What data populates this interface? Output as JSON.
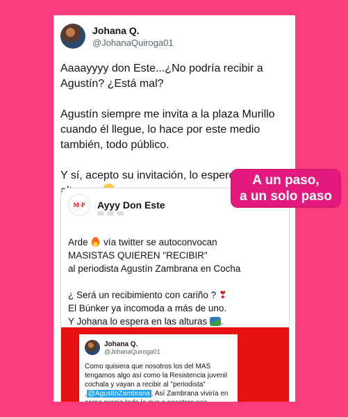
{
  "tweet": {
    "display_name": "Johana Q.",
    "handle": "@JohanaQuiroga01",
    "paragraphs": [
      "Aaaayyyy don Este...¿No podría recibir a Agustín? ¿Está mal?",
      "Agustín siempre me invita a la plaza Murillo cuando él llegue, lo hace por este medio también, todo público.",
      " Y sí, acepto su invitación, lo espero en las alturas."
    ]
  },
  "quote": {
    "logo_text": "M·P",
    "name": "Ayyy Don Este",
    "line1_a": "Arde",
    "line1_b": "vía twitter se autoconvocan",
    "line2": "MASISTAS QUIEREN \"RECIBIR\"",
    "line3": "al periodista Agustín Zambrana en Cocha",
    "line4": "¿ Será un recibimiento con cariño ?",
    "line5": "El Búnker ya incomoda a más de uno.",
    "line6": "Y Johana lo espera en las alturas"
  },
  "inner_tweet": {
    "display_name": "Johana Q.",
    "handle": "@JohanaQuiroga01",
    "text_before": "Como quisiera que nosotros los del MAS tengamos algo así como la Resistencia juvenil cochala y vayan a recibir al \"periodista\" .",
    "mention": "@AgustinZambrana",
    "text_after": ". Así Zambrana viviría en carne propia todo lo que a nosotros nos hicieron. Pero bueno"
  },
  "sticker": {
    "line1": "A un paso,",
    "line2": "a un solo paso"
  },
  "colors": {
    "background": "#fb3d7f",
    "sticker": "#e3197d",
    "red_panel": "#e61010",
    "mention": "#1da1f2"
  }
}
